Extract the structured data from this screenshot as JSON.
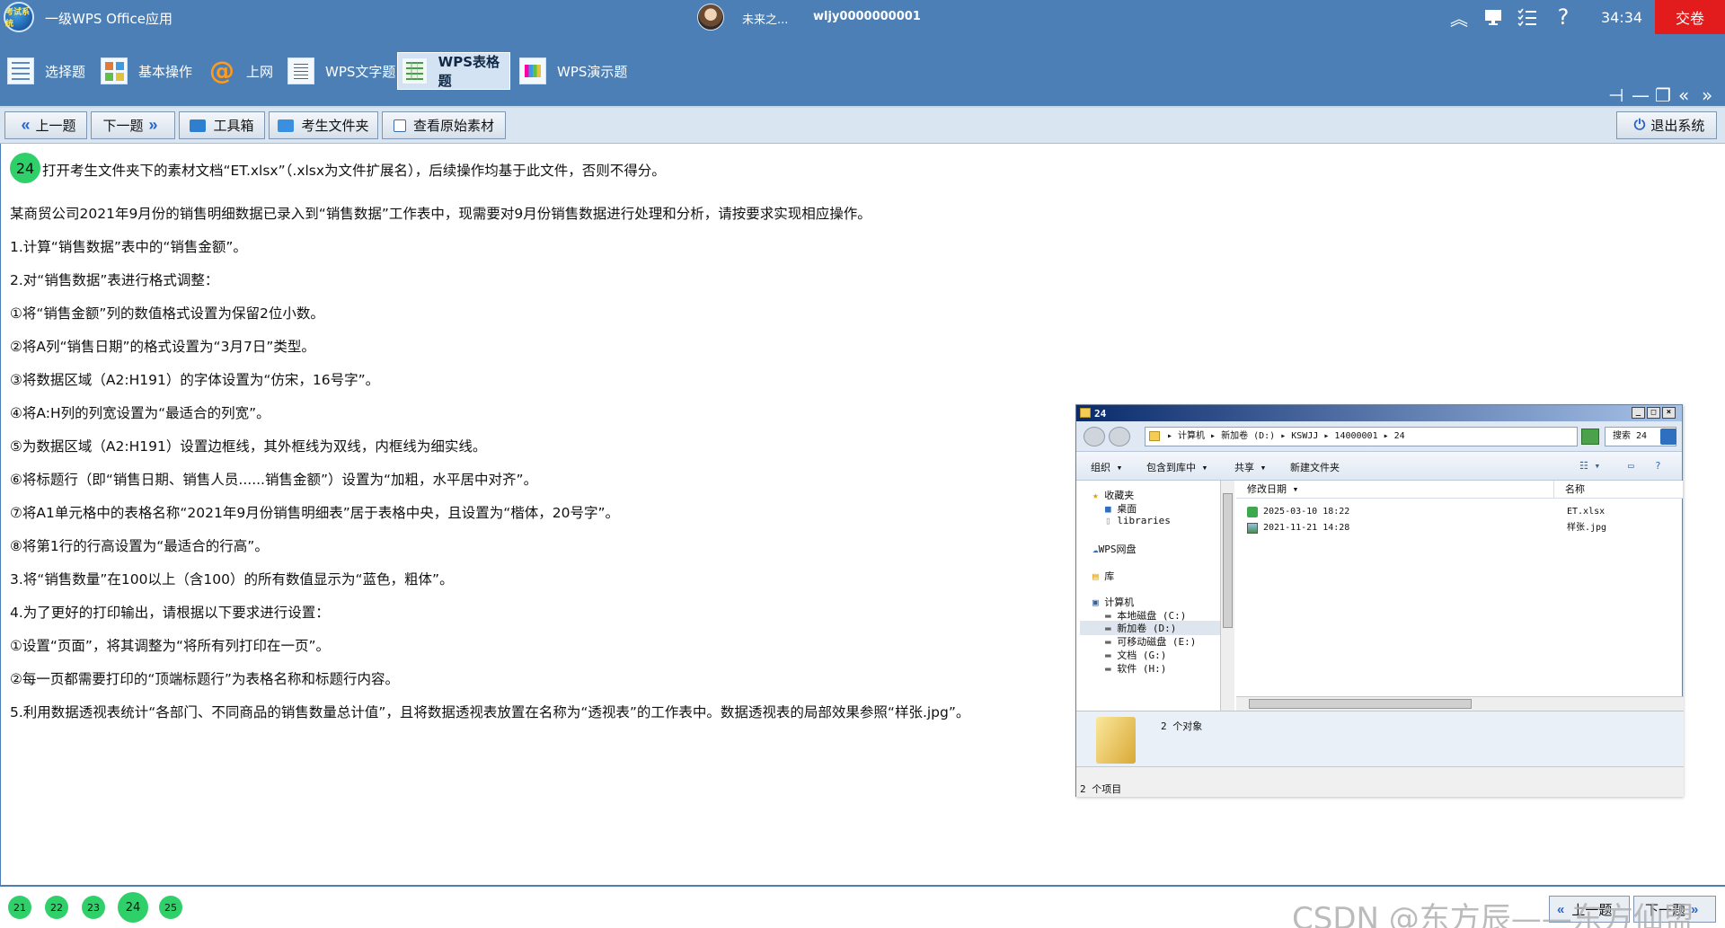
{
  "titlebar": {
    "logo_text": "考试系统",
    "app_title": "一级WPS Office应用",
    "user_name": "未来之...",
    "user_id": "wljy0000000001",
    "timer": "34:34",
    "submit_label": "交卷"
  },
  "menu": [
    {
      "label": "选择题",
      "icon": "list-icon"
    },
    {
      "label": "基本操作",
      "icon": "blocks-icon"
    },
    {
      "label": "上网",
      "icon": "at-icon"
    },
    {
      "label": "WPS文字题",
      "icon": "document-icon"
    },
    {
      "label": "WPS表格题",
      "icon": "spreadsheet-icon"
    },
    {
      "label": "WPS演示题",
      "icon": "presentation-icon"
    }
  ],
  "toolbar": {
    "prev_label": "上一题",
    "next_label": "下一题",
    "toolbox_label": "工具箱",
    "folder_label": "考生文件夹",
    "source_label": "查看原始素材",
    "exit_label": "退出系统"
  },
  "question": {
    "number": "24",
    "lines": [
      "打开考生文件夹下的素材文档“ET.xlsx”（.xlsx为文件扩展名），后续操作均基于此文件，否则不得分。",
      "某商贸公司2021年9月份的销售明细数据已录入到“销售数据”工作表中，现需要对9月份销售数据进行处理和分析，请按要求实现相应操作。",
      "1.计算“销售数据”表中的“销售金额”。",
      "2.对“销售数据”表进行格式调整：",
      "①将“销售金额”列的数值格式设置为保留2位小数。",
      "②将A列“销售日期”的格式设置为“3月7日”类型。",
      "③将数据区域（A2:H191）的字体设置为“仿宋，16号字”。",
      "④将A:H列的列宽设置为“最适合的列宽”。",
      "⑤为数据区域（A2:H191）设置边框线，其外框线为双线，内框线为细实线。",
      "⑥将标题行（即“销售日期、销售人员......销售金额”）设置为“加粗，水平居中对齐”。",
      "⑦将A1单元格中的表格名称“2021年9月份销售明细表”居于表格中央，且设置为“楷体，20号字”。",
      "⑧将第1行的行高设置为“最适合的行高”。",
      "3.将“销售数量”在100以上（含100）的所有数值显示为“蓝色，粗体”。",
      "4.为了更好的打印输出，请根据以下要求进行设置：",
      "①设置“页面”，将其调整为“将所有列打印在一页”。",
      "②每一页都需要打印的“顶端标题行”为表格名称和标题行内容。",
      "5.利用数据透视表统计“各部门、不同商品的销售数量总计值”，且将数据透视表放置在名称为“透视表”的工作表中。数据透视表的局部效果参照“样张.jpg”。"
    ]
  },
  "explorer": {
    "title": "24",
    "path": "▸ 计算机 ▸ 新加卷 (D:) ▸ KSWJJ ▸ 14000001 ▸ 24",
    "search": "搜索 24",
    "commands": [
      "组织 ▾",
      "包含到库中 ▾",
      "共享 ▾",
      "新建文件夹"
    ],
    "tree": {
      "favorites": "收藏夹",
      "desktop": "桌面",
      "libraries_link": "libraries",
      "wps_cloud": "WPS网盘",
      "library": "库",
      "computer": "计算机",
      "drives": [
        "本地磁盘 (C:)",
        "新加卷 (D:)",
        "可移动磁盘 (E:)",
        "文档 (G:)",
        "软件 (H:)"
      ]
    },
    "columns": {
      "modified": "修改日期",
      "name": "名称"
    },
    "files": [
      {
        "date": "2025-03-10 18:22",
        "name": "ET.xlsx"
      },
      {
        "date": "2021-11-21 14:28",
        "name": "样张.jpg"
      }
    ],
    "object_count": "2 个对象",
    "status": "2 个项目"
  },
  "bottom": {
    "questions": [
      "21",
      "22",
      "23",
      "24",
      "25"
    ],
    "current": "24",
    "watermark": "CSDN @东方辰——东方仙盟",
    "prev_label": "上一题",
    "next_label": "下一题"
  },
  "colors": {
    "header_blue": "#4b7fb6",
    "submit_red": "#e21c1c",
    "badge_green": "#2fd06a"
  }
}
